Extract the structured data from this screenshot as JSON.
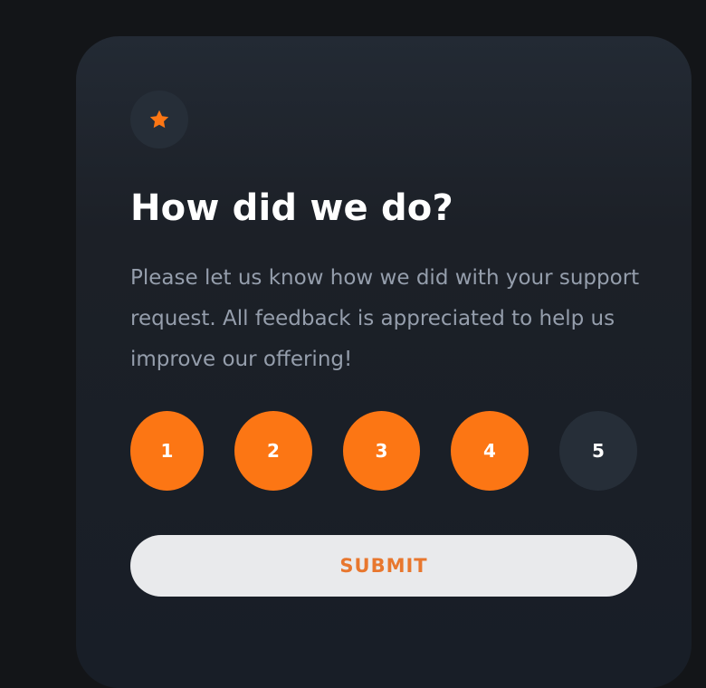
{
  "card": {
    "icon": "star-icon",
    "title": "How did we do?",
    "description": "Please let us know how we did with your support request. All feedback is appreciated to help us improve our offering!"
  },
  "ratings": {
    "options": [
      "1",
      "2",
      "3",
      "4",
      "5"
    ],
    "highlighted": [
      "1",
      "2",
      "3",
      "4"
    ]
  },
  "submit": {
    "label": "SUBMIT"
  },
  "colors": {
    "page_background": "#131518",
    "card_background": "#1f242c",
    "accent": "#fc7614",
    "rating_inactive": "#262e38",
    "title_text": "#ffffff",
    "body_text": "#959eac",
    "submit_background": "#e9eaec",
    "submit_text": "#e8772e"
  }
}
